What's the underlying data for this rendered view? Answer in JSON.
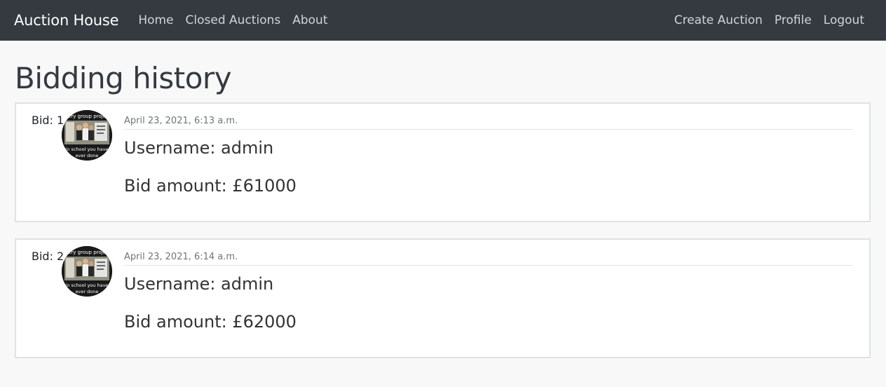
{
  "navbar": {
    "brand": "Auction House",
    "left_links": [
      "Home",
      "Closed Auctions",
      "About"
    ],
    "right_links": [
      "Create Auction",
      "Profile",
      "Logout"
    ]
  },
  "page": {
    "title": "Bidding history"
  },
  "avatar_overlay": {
    "top_text": "ery group proje",
    "bottom_line1": "in school you have",
    "bottom_line2": "ever done"
  },
  "bids": [
    {
      "label": "Bid: 1",
      "timestamp": "April 23, 2021, 6:13 a.m.",
      "username": "Username: admin",
      "amount": "Bid amount: £61000"
    },
    {
      "label": "Bid: 2",
      "timestamp": "April 23, 2021, 6:14 a.m.",
      "username": "Username: admin",
      "amount": "Bid amount: £62000"
    }
  ]
}
